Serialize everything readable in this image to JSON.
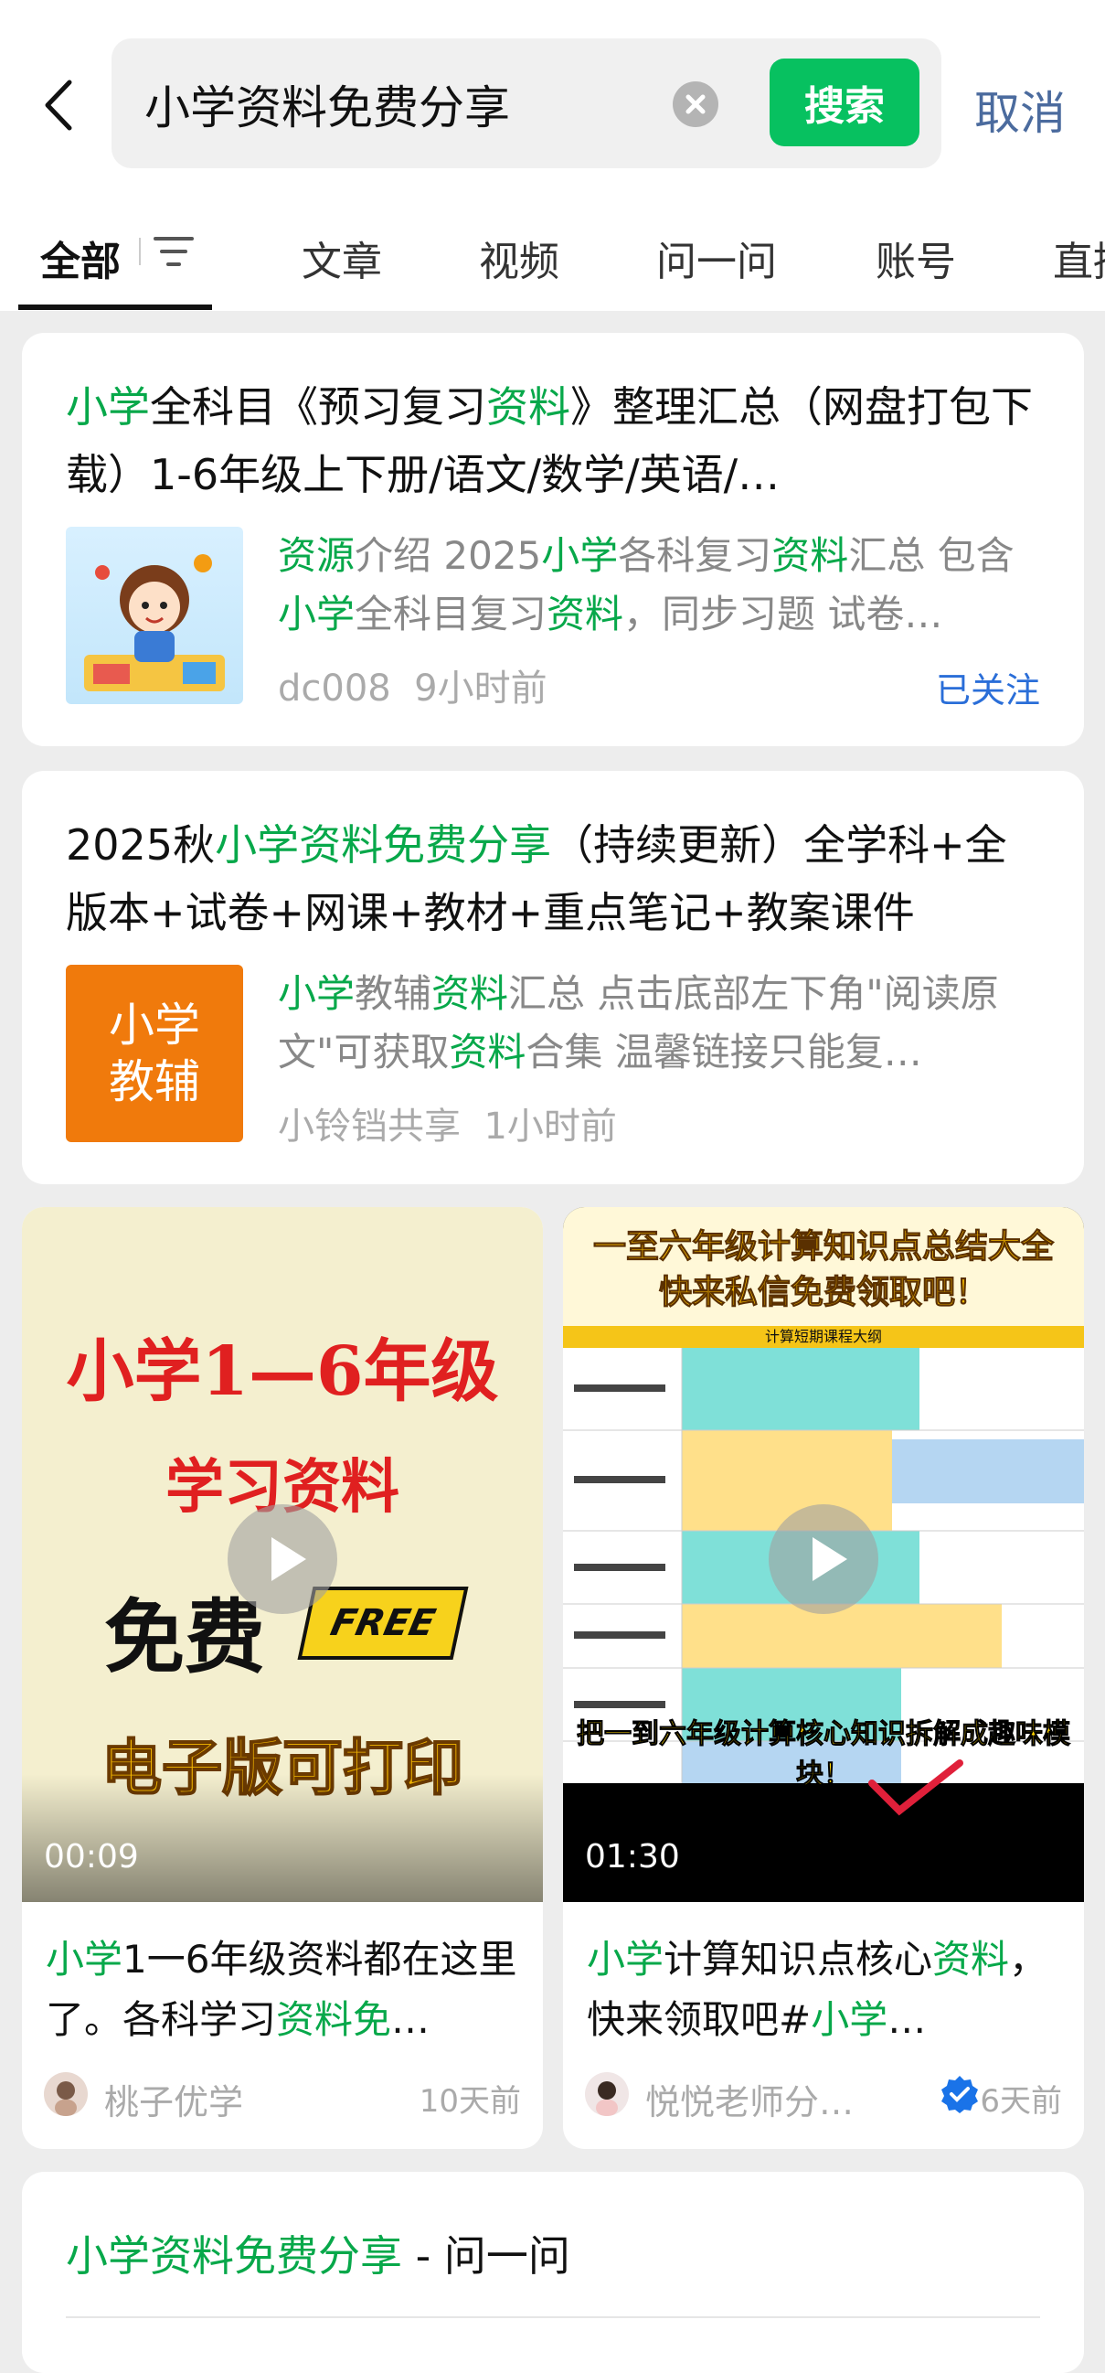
{
  "search": {
    "query": "小学资料免费分享",
    "button_label": "搜索",
    "cancel_label": "取消"
  },
  "tabs": [
    "全部",
    "文章",
    "视频",
    "问一问",
    "账号",
    "直播"
  ],
  "cards": [
    {
      "title_parts": [
        [
          "小学",
          1
        ],
        [
          "全科目《预习复习",
          0
        ],
        [
          "资料",
          1
        ],
        [
          "》整理汇总（网盘打包下载）1-6年级上下册/语文/数学/英语/…",
          0
        ]
      ],
      "desc_parts": [
        [
          "资源",
          1
        ],
        [
          "介绍 2025",
          0
        ],
        [
          "小学",
          1
        ],
        [
          "各科复习",
          0
        ],
        [
          "资料",
          1
        ],
        [
          "汇总 包含",
          0
        ],
        [
          "小学",
          1
        ],
        [
          "全科目复习",
          0
        ],
        [
          "资料",
          1
        ],
        [
          "，同步习题 试卷…",
          0
        ]
      ],
      "author": "dc008",
      "time": "9小时前",
      "follow_label": "已关注"
    },
    {
      "title_parts": [
        [
          "2025秋",
          0
        ],
        [
          "小学资料免费分享",
          1
        ],
        [
          "（持续更新）全学科+全版本+试卷+网课+教材+重点笔记+教案课件",
          0
        ]
      ],
      "desc_parts": [
        [
          "小学",
          1
        ],
        [
          "教辅",
          0
        ],
        [
          "资料",
          1
        ],
        [
          "汇总 点击底部左下角\"阅读原文\"可获取",
          0
        ],
        [
          "资料",
          1
        ],
        [
          "合集 温馨链接只能复…",
          0
        ]
      ],
      "thumb_text": [
        "小学",
        "教辅"
      ],
      "author": "小铃铛共享",
      "time": "1小时前"
    }
  ],
  "videos": [
    {
      "duration": "00:09",
      "title_parts": [
        [
          "小学",
          1
        ],
        [
          "1一6年级资料都在这里了。各科学习",
          0
        ],
        [
          "资料免",
          1
        ],
        [
          "…",
          0
        ]
      ],
      "author": "桃子优学",
      "time": "10天前",
      "thumb_lines": [
        "小学1—6年级",
        "学习资料",
        "免费",
        "FREE",
        "电子版可打印"
      ]
    },
    {
      "duration": "01:30",
      "title_parts": [
        [
          "小学",
          1
        ],
        [
          "计算知识点核心",
          0
        ],
        [
          "资料",
          1
        ],
        [
          "，快来领取吧#",
          0
        ],
        [
          "小学",
          1
        ],
        [
          "…",
          0
        ]
      ],
      "author": "悦悦老师分…",
      "time": "6天前",
      "thumb_lines": [
        "一至六年级计算知识点总结大全",
        "快来私信免费领取吧！",
        "计算短期课程大纲",
        "把一到六年级计算核心知识拆解成趣味模块！"
      ]
    }
  ],
  "qa_card": {
    "title_hl": "小学资料免费分享",
    "title_rest": " - 问一问"
  },
  "colors": {
    "accent": "#07c160",
    "highlight": "#07a84a",
    "link": "#2a6ed8",
    "cancel": "#4b6b9e",
    "thumb_orange": "#f07a0c"
  }
}
